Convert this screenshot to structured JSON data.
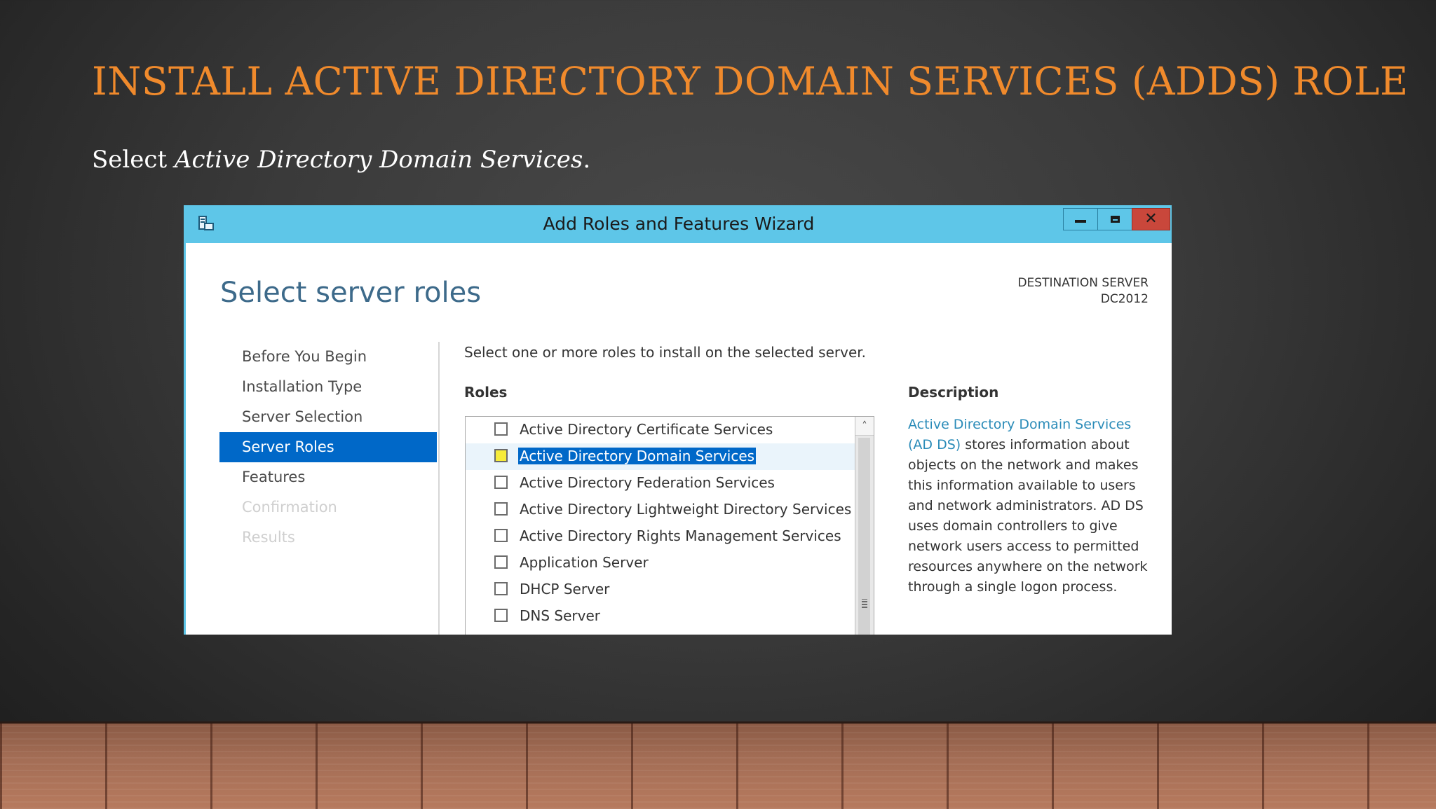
{
  "slide": {
    "title": "INSTALL ACTIVE DIRECTORY DOMAIN SERVICES (ADDS) ROLE",
    "subtitle_prefix": "Select ",
    "subtitle_emphasis": "Active Directory Domain Services",
    "subtitle_suffix": "."
  },
  "wizard": {
    "title": "Add Roles and Features Wizard",
    "page_heading": "Select server roles",
    "destination_label": "DESTINATION SERVER",
    "destination_value": "DC2012",
    "nav_items": [
      {
        "label": "Before You Begin",
        "state": "normal"
      },
      {
        "label": "Installation Type",
        "state": "normal"
      },
      {
        "label": "Server Selection",
        "state": "normal"
      },
      {
        "label": "Server Roles",
        "state": "active"
      },
      {
        "label": "Features",
        "state": "normal"
      },
      {
        "label": "Confirmation",
        "state": "disabled"
      },
      {
        "label": "Results",
        "state": "disabled"
      }
    ],
    "instruction": "Select one or more roles to install on the selected server.",
    "roles_heading": "Roles",
    "roles": [
      {
        "label": "Active Directory Certificate Services",
        "checked": false
      },
      {
        "label": "Active Directory Domain Services",
        "checked": false
      },
      {
        "label": "Active Directory Federation Services",
        "checked": false
      },
      {
        "label": "Active Directory Lightweight Directory Services",
        "checked": false
      },
      {
        "label": "Active Directory Rights Management Services",
        "checked": false
      },
      {
        "label": "Application Server",
        "checked": false
      },
      {
        "label": "DHCP Server",
        "checked": false
      },
      {
        "label": "DNS Server",
        "checked": false
      }
    ],
    "selected_role": "Active Directory Domain Services",
    "description_heading": "Description",
    "description_link": "Active Directory Domain Services (AD DS)",
    "description_text": " stores information about objects on the network and makes this information available to users and network administrators. AD DS uses domain controllers to give network users access to permitted resources anywhere on the network through a single logon process."
  },
  "icons": {
    "app": "server-manager-icon",
    "minimize": "minimize-icon",
    "maximize": "maximize-icon",
    "close": "close-icon",
    "scroll_up": "chevron-up-icon"
  },
  "colors": {
    "title_orange": "#f08a2c",
    "titlebar_blue": "#5ec6e8",
    "selection_blue": "#0068c8",
    "close_red": "#c9473b",
    "checkbox_highlight": "#f7ec3a",
    "link_blue": "#2a8bb8"
  }
}
